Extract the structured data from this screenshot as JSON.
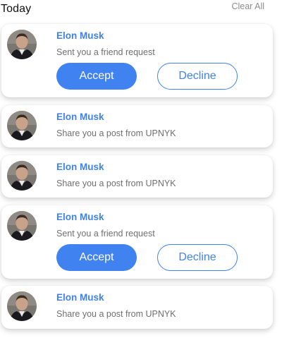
{
  "header": {
    "title": "Today",
    "clear_all": "Clear All"
  },
  "notifications": [
    {
      "name": "Elon Musk",
      "message": "Sent you a friend request",
      "type": "friend_request",
      "accept_label": "Accept",
      "decline_label": "Decline"
    },
    {
      "name": "Elon Musk",
      "message": "Share you a post from UPNYK",
      "type": "post_share"
    },
    {
      "name": "Elon Musk",
      "message": "Share you a post from UPNYK",
      "type": "post_share"
    },
    {
      "name": "Elon Musk",
      "message": "Sent you a friend request",
      "type": "friend_request",
      "accept_label": "Accept",
      "decline_label": "Decline"
    },
    {
      "name": "Elon Musk",
      "message": "Share you a post from UPNYK",
      "type": "post_share"
    }
  ],
  "colors": {
    "accent": "#3f82f0",
    "name_text": "#3f82e9",
    "message_text": "#6f6f6f",
    "muted": "#8d8d8d"
  },
  "icons": {
    "avatar": "user-avatar-photo"
  }
}
